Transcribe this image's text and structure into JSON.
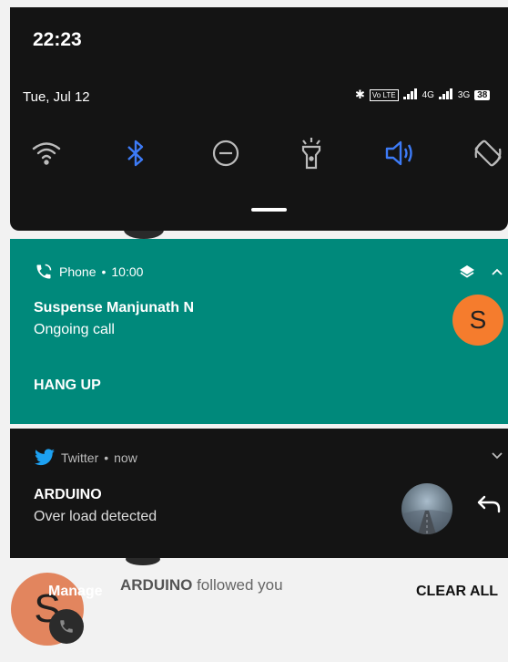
{
  "status_bar": {
    "time": "22:23",
    "date": "Tue, Jul 12",
    "bt_symbol": "✱",
    "volte": "Vo LTE",
    "net1": "4G",
    "net2": "3G",
    "battery": "38"
  },
  "quick_settings": {
    "tiles": [
      {
        "icon": "wifi-icon",
        "active": false
      },
      {
        "icon": "bluetooth-icon",
        "active": true
      },
      {
        "icon": "do-not-disturb-icon",
        "active": false
      },
      {
        "icon": "flashlight-icon",
        "active": false
      },
      {
        "icon": "sound-icon",
        "active": true
      },
      {
        "icon": "auto-rotate-icon",
        "active": false
      }
    ],
    "active_color": "#3d7bf7"
  },
  "phone_notification": {
    "app": "Phone",
    "time": "10:00",
    "title": "Suspense Manjunath N",
    "text": "Ongoing call",
    "action": "HANG UP",
    "avatar_letter": "S",
    "color": "#00897b"
  },
  "twitter_notification": {
    "app": "Twitter",
    "time": "now",
    "title": "ARDUINO",
    "text": "Over load detected",
    "color": "#1da1f2"
  },
  "background": {
    "sender": "ARDUINO",
    "text": "followed you",
    "avatar_letter": "S"
  },
  "footer": {
    "manage": "Manage",
    "clear_all": "CLEAR ALL"
  }
}
